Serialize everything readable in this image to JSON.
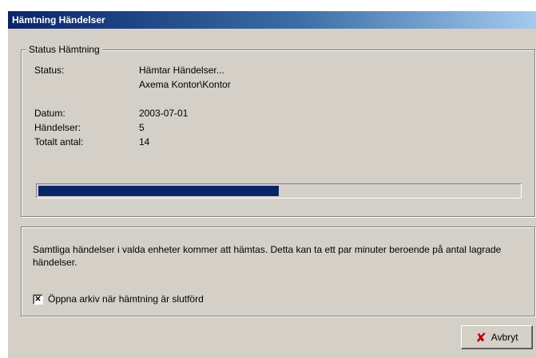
{
  "window": {
    "title": "Hämtning Händelser"
  },
  "status_group": {
    "legend": "Status Hämtning",
    "status_label": "Status:",
    "status_value_line1": "Hämtar Händelser...",
    "status_value_line2": "Axema Kontor\\Kontor",
    "date_label": "Datum:",
    "date_value": "2003-07-01",
    "events_label": "Händelser:",
    "events_value": "5",
    "total_label": "Totalt antal:",
    "total_value": "14",
    "progress_percent": 50
  },
  "info_group": {
    "description": "Samtliga händelser i valda enheter kommer att hämtas. Detta kan ta ett par minuter beroende på antal lagrade händelser.",
    "checkbox_label": "Öppna arkiv när hämtning är slutförd",
    "checkbox_checked": true,
    "checkbox_mark": "✕"
  },
  "actions": {
    "cancel_label": "Avbryt",
    "cancel_icon": "close-icon",
    "cancel_icon_glyph": "✘"
  },
  "colors": {
    "titlebar_start": "#0a246a",
    "progress_fill": "#0a246a",
    "window_bg": "#d4d0c8",
    "cancel_icon": "#c00000"
  }
}
